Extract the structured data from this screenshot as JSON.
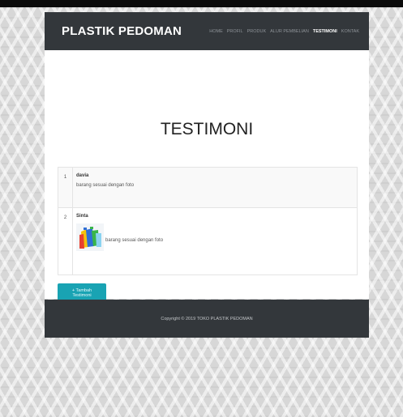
{
  "navbar": {
    "brand": "PLASTIK PEDOMAN",
    "items": [
      "HOME",
      "PROFIL",
      "PRODUK",
      "ALUR PEMBELIAN",
      "TESTIMONI",
      "KONTAK"
    ],
    "active": "TESTIMONI"
  },
  "main": {
    "title": "TESTIMONI",
    "testimonials": [
      {
        "no": "1",
        "name": "davia",
        "message": "barang sesuai dengan foto"
      },
      {
        "no": "2",
        "name": "Sinta",
        "message": "barang sesuai dengan foto",
        "image_icon": "plastic-bags-photo"
      }
    ],
    "add_button": "+ Tambah Testimoni"
  },
  "footer": {
    "copyright": "Copyright © 2019 TOKO PLASTIK PEDOMAN"
  },
  "colors": {
    "navbar": "#33373b",
    "accent_button": "#19a3b3",
    "background": "#d7d7d7"
  }
}
